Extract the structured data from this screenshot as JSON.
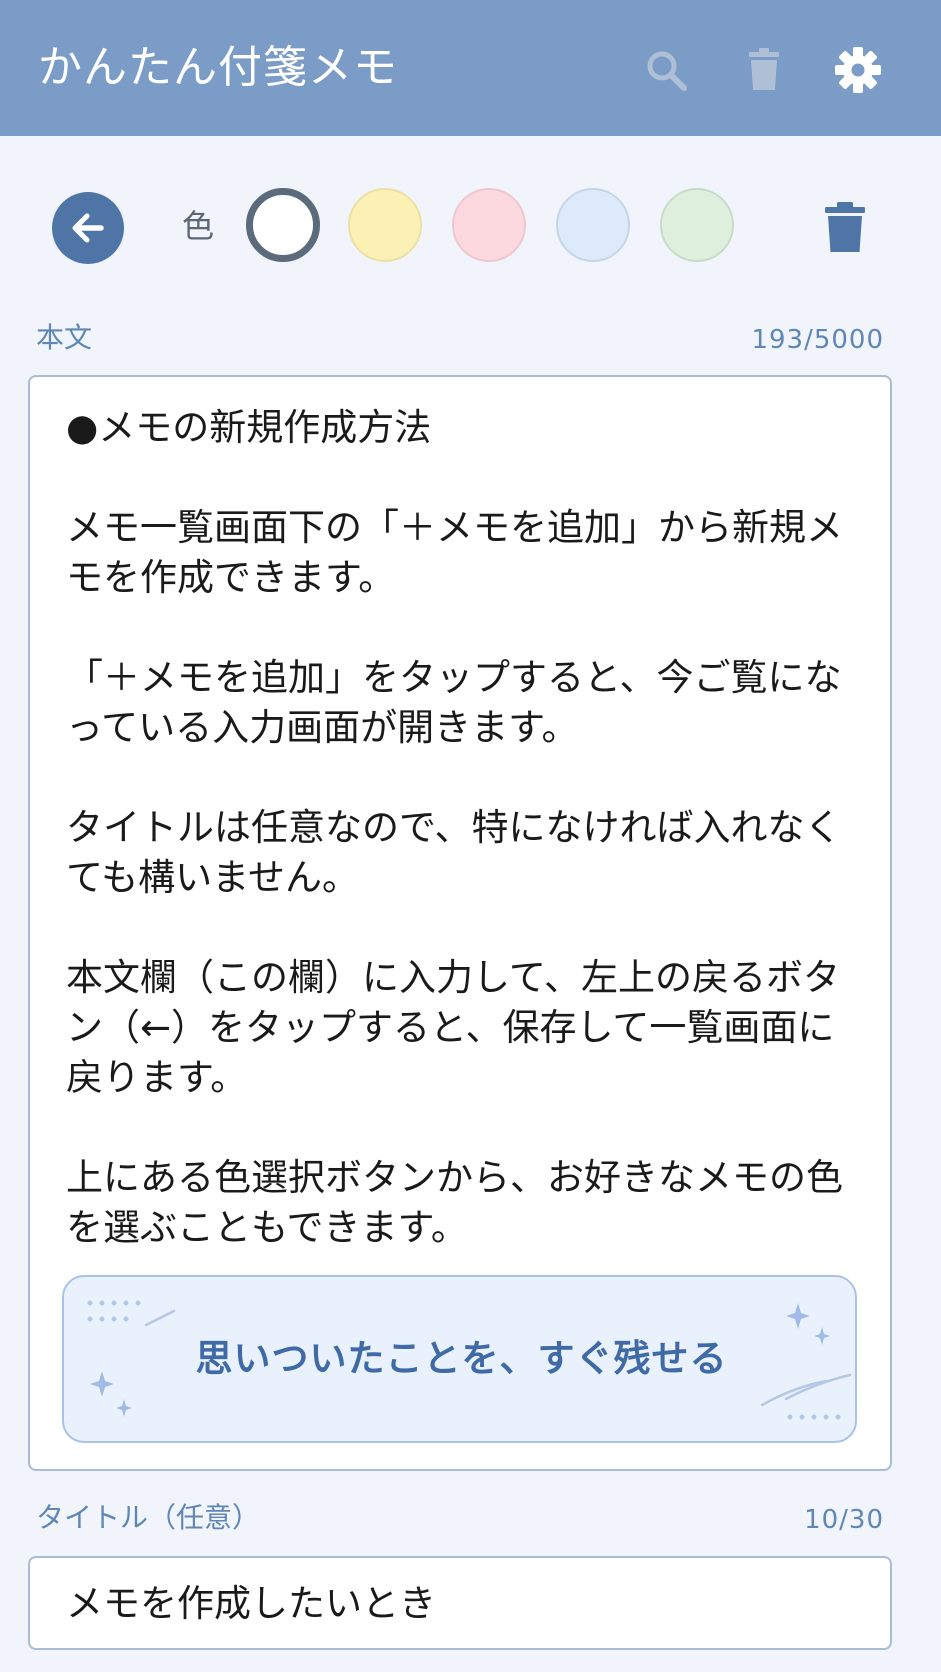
{
  "app": {
    "title": "かんたん付箋メモ"
  },
  "appbar": {
    "icons": [
      {
        "name": "search-icon",
        "enabled": false
      },
      {
        "name": "delete-icon",
        "enabled": false
      },
      {
        "name": "settings-icon",
        "enabled": true
      }
    ]
  },
  "toolbar": {
    "back_icon": "arrow-left-icon",
    "color_label": "色",
    "colors": [
      {
        "name": "white",
        "hex": "#ffffff",
        "selected": true
      },
      {
        "name": "yellow",
        "hex": "#fbf1b4",
        "selected": false
      },
      {
        "name": "pink",
        "hex": "#fcd9df",
        "selected": false
      },
      {
        "name": "blue",
        "hex": "#dceafa",
        "selected": false
      },
      {
        "name": "green",
        "hex": "#deefdd",
        "selected": false
      }
    ],
    "trash_icon": "trash-icon"
  },
  "body": {
    "label": "本文",
    "counter": "193/5000",
    "text": "●メモの新規作成方法\n\nメモ一覧画面下の「＋メモを追加」から新規メモを作成できます。\n\n「＋メモを追加」をタップすると、今ご覧になっている入力画面が開きます。\n\nタイトルは任意なので、特になければ入れなくても構いません。\n\n本文欄（この欄）に入力して、左上の戻るボタン（←）をタップすると、保存して一覧画面に戻ります。\n\n上にある色選択ボタンから、お好きなメモの色を選ぶこともできます。"
  },
  "banner": {
    "text": "思いついたことを、すぐ残せる"
  },
  "title_field": {
    "label": "タイトル（任意）",
    "counter": "10/30",
    "value": "メモを作成したいとき"
  },
  "colors": {
    "appbar": "#7b9cc6",
    "accent": "#4f74a6",
    "label": "#5f86b5",
    "background": "#f1f5fb"
  }
}
